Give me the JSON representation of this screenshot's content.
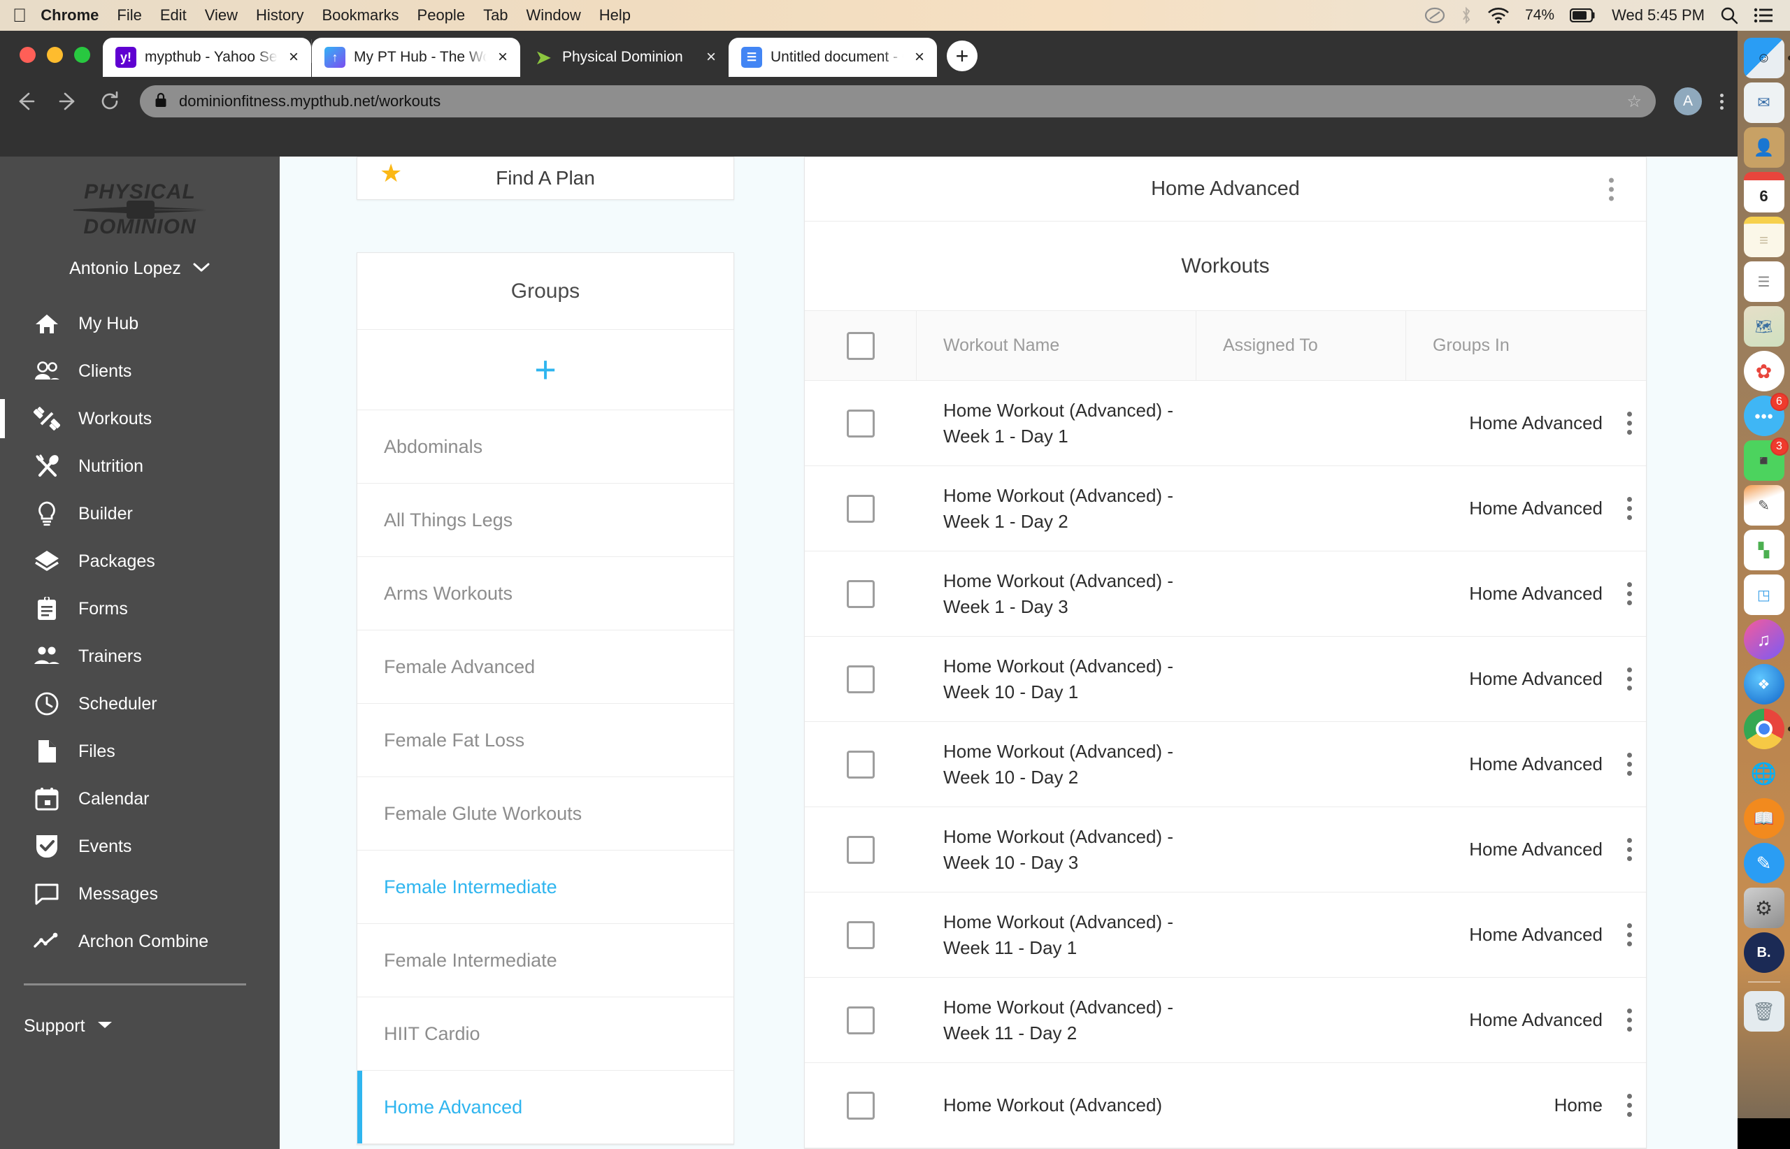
{
  "menubar": {
    "apple_icon": "apple-icon",
    "items": [
      "Chrome",
      "File",
      "Edit",
      "View",
      "History",
      "Bookmarks",
      "People",
      "Tab",
      "Window",
      "Help"
    ],
    "active_app": "Chrome",
    "battery": "74%",
    "clock": "Wed 5:45 PM",
    "icons": [
      "creative-cloud-icon",
      "bluetooth-icon",
      "wifi-icon",
      "battery-icon",
      "spotlight-search-icon",
      "control-center-icon"
    ]
  },
  "browser": {
    "tabs": [
      {
        "title": "mypthub - Yahoo Search Resul",
        "favicon": "yahoo-icon",
        "favicon_color": "#5f01d1",
        "favicon_glyph": "y!",
        "active": false
      },
      {
        "title": "My PT Hub - The World's Numl",
        "favicon": "mypthub-icon",
        "favicon_color": "#3aa0f0",
        "favicon_glyph": "↑",
        "active": false
      },
      {
        "title": "Physical Dominion",
        "favicon": "physical-dominion-icon",
        "favicon_color": "#8cc63f",
        "favicon_glyph": "➤",
        "active": true
      },
      {
        "title": "Untitled document - Google Do",
        "favicon": "google-docs-icon",
        "favicon_color": "#4285f4",
        "favicon_glyph": "☰",
        "active": false
      }
    ],
    "new_tab_label": "+",
    "close_label": "×",
    "url": "dominionfitness.mypthub.net/workouts",
    "lock_icon": "lock-icon",
    "back_icon": "back-arrow-icon",
    "forward_icon": "forward-arrow-icon",
    "reload_icon": "reload-icon",
    "bookmark_icon": "star-icon",
    "profile_initial": "A",
    "menu_icon": "three-dot-menu-icon"
  },
  "sidebar": {
    "logo_top": "PHYSICAL",
    "logo_bottom": "DOMINION",
    "user_name": "Antonio Lopez",
    "user_chevron": "chevron-down-icon",
    "items": [
      {
        "label": "My Hub",
        "icon": "home-icon",
        "active": false
      },
      {
        "label": "Clients",
        "icon": "people-icon",
        "active": false
      },
      {
        "label": "Workouts",
        "icon": "dumbbell-icon",
        "active": true
      },
      {
        "label": "Nutrition",
        "icon": "fork-spoon-icon",
        "active": false
      },
      {
        "label": "Builder",
        "icon": "lightbulb-icon",
        "active": false
      },
      {
        "label": "Packages",
        "icon": "layers-icon",
        "active": false
      },
      {
        "label": "Forms",
        "icon": "clipboard-icon",
        "active": false
      },
      {
        "label": "Trainers",
        "icon": "trainers-icon",
        "active": false
      },
      {
        "label": "Scheduler",
        "icon": "clock-icon",
        "active": false
      },
      {
        "label": "Files",
        "icon": "file-icon",
        "active": false
      },
      {
        "label": "Calendar",
        "icon": "calendar-icon",
        "active": false
      },
      {
        "label": "Events",
        "icon": "shield-check-icon",
        "active": false
      },
      {
        "label": "Messages",
        "icon": "chat-bubble-icon",
        "active": false
      },
      {
        "label": "Archon Combine",
        "icon": "line-chart-icon",
        "active": false
      }
    ],
    "support_label": "Support",
    "support_caret": "caret-down-icon"
  },
  "groups_panel": {
    "find_a_plan_label": "Find A Plan",
    "find_a_plan_icon": "star-icon",
    "header": "Groups",
    "add_label": "+",
    "items": [
      {
        "label": "Abdominals",
        "state": "normal"
      },
      {
        "label": "All Things Legs",
        "state": "normal"
      },
      {
        "label": "Arms Workouts",
        "state": "normal"
      },
      {
        "label": "Female Advanced",
        "state": "normal"
      },
      {
        "label": "Female Fat Loss",
        "state": "normal"
      },
      {
        "label": "Female Glute Workouts",
        "state": "normal"
      },
      {
        "label": "Female Intermediate",
        "state": "highlighted"
      },
      {
        "label": "Female Intermediate",
        "state": "normal"
      },
      {
        "label": "HIIT Cardio",
        "state": "normal"
      },
      {
        "label": "Home Advanced",
        "state": "selected"
      }
    ]
  },
  "workouts_panel": {
    "title": "Home Advanced",
    "title_menu_icon": "three-dot-menu-icon",
    "subtitle": "Workouts",
    "columns": [
      "",
      "Workout Name",
      "Assigned To",
      "Groups In"
    ],
    "header_checkbox": "select-all-checkbox",
    "rows": [
      {
        "name": "Home Workout (Advanced) - Week 1 - Day 1",
        "assigned_to": "",
        "groups_in": "Home Advanced"
      },
      {
        "name": "Home Workout (Advanced) - Week 1 - Day 2",
        "assigned_to": "",
        "groups_in": "Home Advanced"
      },
      {
        "name": "Home Workout (Advanced) - Week 1 - Day 3",
        "assigned_to": "",
        "groups_in": "Home Advanced"
      },
      {
        "name": "Home Workout (Advanced) - Week 10 - Day 1",
        "assigned_to": "",
        "groups_in": "Home Advanced"
      },
      {
        "name": "Home Workout (Advanced) - Week 10 - Day 2",
        "assigned_to": "",
        "groups_in": "Home Advanced"
      },
      {
        "name": "Home Workout (Advanced) - Week 10 - Day 3",
        "assigned_to": "",
        "groups_in": "Home Advanced"
      },
      {
        "name": "Home Workout (Advanced) - Week 11 - Day 1",
        "assigned_to": "",
        "groups_in": "Home Advanced"
      },
      {
        "name": "Home Workout (Advanced) - Week 11 - Day 2",
        "assigned_to": "",
        "groups_in": "Home Advanced"
      },
      {
        "name": "Home Workout (Advanced)",
        "assigned_to": "",
        "groups_in": "Home"
      }
    ]
  },
  "dock": {
    "items": [
      {
        "name": "finder-icon",
        "glyph": "🙂",
        "color": "#2a9df4",
        "badge": "",
        "running": true
      },
      {
        "name": "mail-icon",
        "glyph": "✉",
        "color": "#eeeeee",
        "badge": "",
        "running": false
      },
      {
        "name": "contacts-icon",
        "glyph": "👤",
        "color": "#c8a165",
        "badge": "",
        "running": false
      },
      {
        "name": "calendar-icon",
        "glyph": "6",
        "color": "#ffffff",
        "badge": "",
        "running": false
      },
      {
        "name": "notes-icon",
        "glyph": "≡",
        "color": "#f7f2e0",
        "badge": "",
        "running": false
      },
      {
        "name": "reminders-icon",
        "glyph": "☰",
        "color": "#ffffff",
        "badge": "",
        "running": false
      },
      {
        "name": "maps-icon",
        "glyph": "🗺",
        "color": "#d8e6c8",
        "badge": "",
        "running": false
      },
      {
        "name": "photos-icon",
        "glyph": "✿",
        "color": "#ffffff",
        "badge": "",
        "running": false
      },
      {
        "name": "messages-icon",
        "glyph": "●●●",
        "color": "#3fb6f5",
        "badge": "6",
        "running": false
      },
      {
        "name": "facetime-icon",
        "glyph": "■",
        "color": "#4cd35e",
        "badge": "3",
        "running": false
      },
      {
        "name": "pages-icon",
        "glyph": "✎",
        "color": "#f2994a",
        "badge": "",
        "running": false
      },
      {
        "name": "numbers-icon",
        "glyph": "▐",
        "color": "#ffffff",
        "badge": "",
        "running": false
      },
      {
        "name": "keynote-icon",
        "glyph": "◳",
        "color": "#3aa0e8",
        "badge": "",
        "running": false
      },
      {
        "name": "itunes-icon",
        "glyph": "♫",
        "color": "#ffffff",
        "badge": "",
        "running": false
      },
      {
        "name": "safari-icon",
        "glyph": "✦",
        "color": "#1e8fe0",
        "badge": "",
        "running": false
      },
      {
        "name": "chrome-icon",
        "glyph": "◉",
        "color": "#ffffff",
        "badge": "",
        "running": true
      },
      {
        "name": "secure-browser-icon",
        "glyph": "🔒",
        "color": "#5aa9e6",
        "badge": "",
        "running": false
      },
      {
        "name": "ibooks-icon",
        "glyph": "📖",
        "color": "#f28a1e",
        "badge": "",
        "running": false
      },
      {
        "name": "app-store-icon",
        "glyph": "A",
        "color": "#2a9df4",
        "badge": "",
        "running": false
      },
      {
        "name": "system-preferences-icon",
        "glyph": "⚙",
        "color": "#9a9a9a",
        "badge": "",
        "running": false
      },
      {
        "name": "backblaze-icon",
        "glyph": "B.",
        "color": "#1b2a55",
        "badge": "",
        "running": false
      },
      {
        "name": "trash-icon",
        "glyph": "🗑",
        "color": "#dfe6ea",
        "badge": "",
        "running": false
      }
    ]
  },
  "colors": {
    "accent": "#2fb5ef",
    "sidebar_bg": "#4b4b4b",
    "page_bg": "#f4fbfd",
    "badge_red": "#ef3b2d",
    "star_yellow": "#fbb816"
  }
}
